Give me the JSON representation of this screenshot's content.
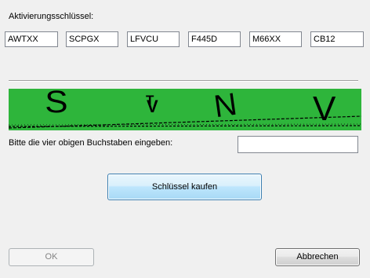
{
  "activation": {
    "label": "Aktivierungsschlüssel:",
    "fields": [
      "AWTXX",
      "SCPGX",
      "LFVCU",
      "F445D",
      "M66XX",
      "CB12"
    ]
  },
  "captcha": {
    "letters": [
      "S",
      "V",
      "N",
      "V"
    ],
    "small_letters": [
      "T"
    ],
    "background_color": "#2eb53b",
    "prompt": "Bitte die vier obigen Buchstaben eingeben:",
    "input_value": ""
  },
  "buttons": {
    "buy": "Schlüssel kaufen",
    "ok": "OK",
    "cancel": "Abbrechen"
  }
}
